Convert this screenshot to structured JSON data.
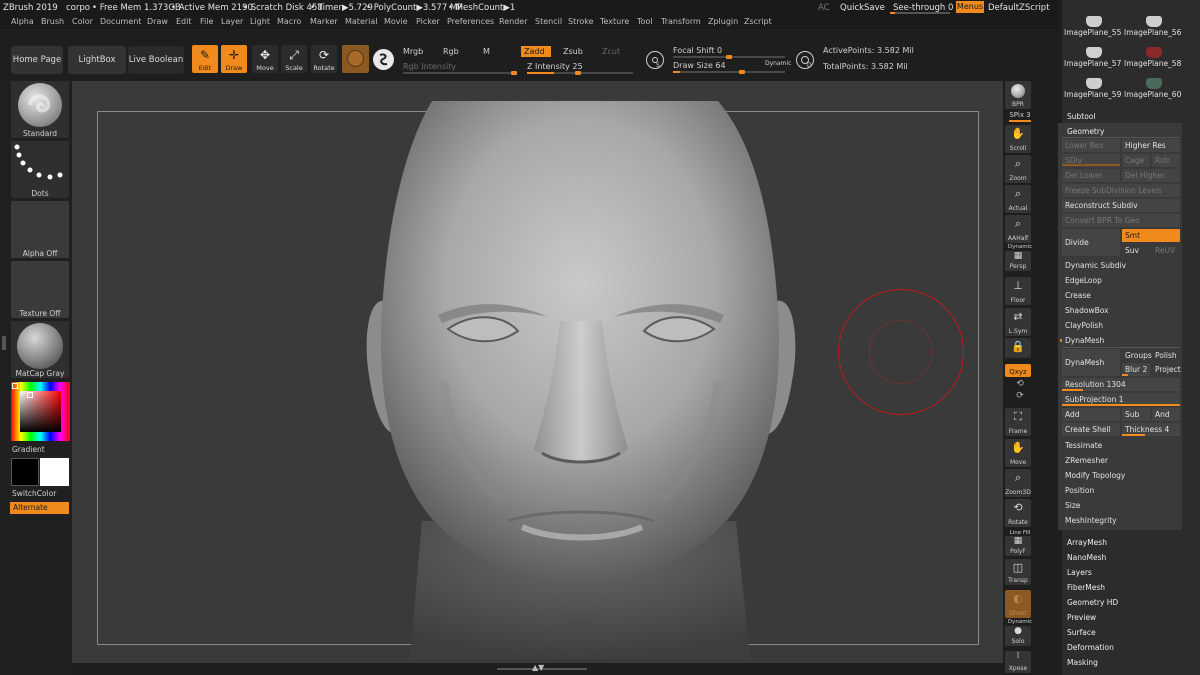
{
  "titlebar": {
    "app": "ZBrush 2019",
    "project": "corpo",
    "free_mem": "• Free Mem 1.373GB",
    "active_mem": "• Active Mem 2190",
    "scratch": "• Scratch Disk 458",
    "timer": "• Timer▶5.729",
    "polycount": "• PolyCount▶3.577 MP",
    "meshcount": "• MeshCount▶1",
    "ac": "AC",
    "quicksave": "QuickSave",
    "see_through": "See-through  0",
    "see_through_value": 0,
    "menus": "Menus",
    "script": "DefaultZScript"
  },
  "menubar": [
    "Alpha",
    "Brush",
    "Color",
    "Document",
    "Draw",
    "Edit",
    "File",
    "Layer",
    "Light",
    "Macro",
    "Marker",
    "Material",
    "Movie",
    "Picker",
    "Preferences",
    "Render",
    "Stencil",
    "Stroke",
    "Texture",
    "Tool",
    "Transform",
    "Zplugin",
    "Zscript"
  ],
  "shelf": {
    "home": "Home Page",
    "lightbox": "LightBox",
    "live_boolean": "Live Boolean",
    "edit": "Edit",
    "draw": "Draw",
    "move": "Move",
    "scale": "Scale",
    "rotate": "Rotate",
    "mrgb": "Mrgb",
    "rgb": "Rgb",
    "m": "M",
    "zadd": "Zadd",
    "zsub": "Zsub",
    "zcut": "Zcut",
    "rgb_intensity": "Rgb Intensity",
    "z_intensity": "Z Intensity 25",
    "z_intensity_value": 25,
    "focal_shift": "Focal Shift 0",
    "focal_shift_value": 0,
    "draw_size": "Draw Size 64",
    "draw_size_value": 64,
    "dynamic": "Dynamic",
    "active_points": "ActivePoints: 3.582 Mil",
    "total_points": "TotalPoints: 3.582 Mil"
  },
  "left": {
    "brush": "Standard",
    "stroke": "Dots",
    "alpha": "Alpha Off",
    "texture": "Texture Off",
    "material": "MatCap Gray",
    "gradient": "Gradient",
    "switch_color": "SwitchColor",
    "alternate": "Alternate"
  },
  "right_strip": {
    "bpr": "BPR",
    "spix": "SPix 3",
    "spix_value": 3,
    "scroll": "Scroll",
    "zoom": "Zoom",
    "actual": "Actual",
    "aahalf": "AAHalf",
    "dynamic": "Dynamic",
    "persp": "Persp",
    "floor": "Floor",
    "lsym": "L.Sym",
    "xyz": "Qxyz",
    "frame": "Frame",
    "move": "Move",
    "zoom3d": "Zoom3D",
    "rotate": "Rotate",
    "line_fill": "Line Fill",
    "polyf": "PolyF",
    "transp": "Transp",
    "ghost": "Ghost",
    "dynamic2": "Dynamic",
    "solo": "Solo",
    "xpose": "Xpose"
  },
  "palette": {
    "thumbs": [
      "ImagePlane_55",
      "ImagePlane_56",
      "ImagePlane_57",
      "ImagePlane_58",
      "ImagePlane_59",
      "ImagePlane_60"
    ],
    "subtool": "Subtool",
    "geometry": "Geometry",
    "lower_res": "Lower Res",
    "higher_res": "Higher Res",
    "sdiv": "SDiv",
    "cage": "Cage",
    "rstr": "Rstr",
    "del_lower": "Del Lower",
    "del_higher": "Del Higher",
    "freeze": "Freeze SubDivision Levels",
    "reconstruct": "Reconstruct Subdiv",
    "convert_bpr": "Convert BPR To Geo",
    "divide": "Divide",
    "smt": "Smt",
    "suv": "Suv",
    "reuv": "ReUV",
    "dynamic_subdiv": "Dynamic Subdiv",
    "edgeloop": "EdgeLoop",
    "crease": "Crease",
    "shadowbox": "ShadowBox",
    "claypolish": "ClayPolish",
    "dynamesh_hdr": "DynaMesh",
    "dynamesh_btn": "DynaMesh",
    "groups": "Groups",
    "polish": "Polish",
    "blur": "Blur 2",
    "project": "Project",
    "resolution": "Resolution 1304",
    "subprojection": "SubProjection 1",
    "add": "Add",
    "sub": "Sub",
    "and": "And",
    "create_shell": "Create Shell",
    "thickness": "Thickness 4",
    "tessimate": "Tessimate",
    "zremesher": "ZRemesher",
    "modify_topology": "Modify Topology",
    "position": "Position",
    "size": "Size",
    "meshintegrity": "MeshIntegrity",
    "sections": [
      "ArrayMesh",
      "NanoMesh",
      "Layers",
      "FiberMesh",
      "Geometry HD",
      "Preview",
      "Surface",
      "Deformation",
      "Masking"
    ]
  },
  "colors": {
    "accent": "#f08a1c",
    "canvas": "#3a3a3a",
    "panel": "#2c2c2c",
    "brush_ring": "#c0191b"
  }
}
